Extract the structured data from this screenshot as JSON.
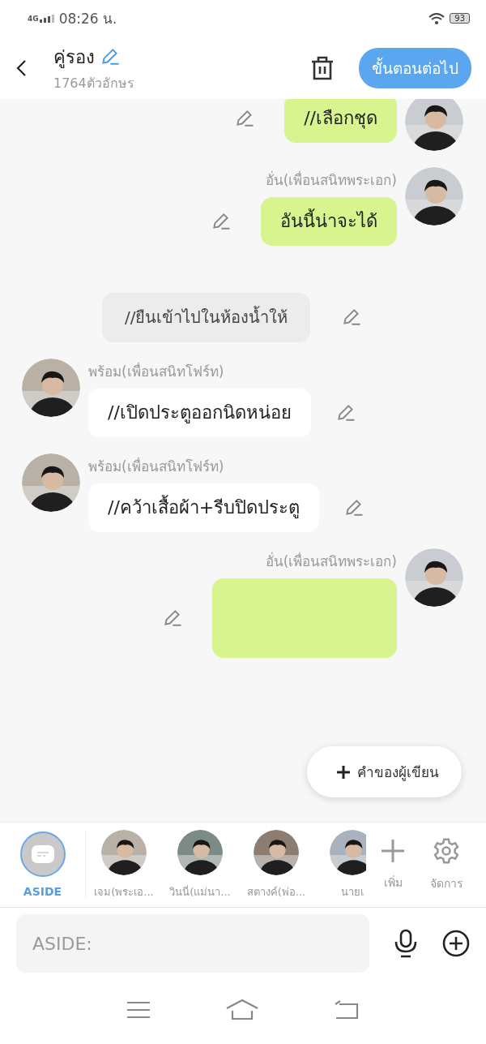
{
  "status_bar": {
    "network": "4G",
    "time": "08:26 น.",
    "battery": "93"
  },
  "header": {
    "title": "คู่รอง",
    "char_count": "1764ตัวอักษร",
    "next_button": "ขั้นตอนต่อไป"
  },
  "messages": [
    {
      "kind": "right",
      "text": "//เลือกชุด"
    },
    {
      "kind": "right",
      "name": "อั่น(เพื่อนสนิทพระเอก)",
      "text": "อันนี้น่าจะได้"
    },
    {
      "kind": "narration",
      "text": "//ยืนเข้าไปในห้องน้ำให้"
    },
    {
      "kind": "left",
      "name": "พร้อม(เพื่อนสนิทโฟร์ท)",
      "text": "//เปิดประตูออกนิดหน่อย"
    },
    {
      "kind": "left",
      "name": "พร้อม(เพื่อนสนิทโฟร์ท)",
      "text": "//คว้าเสื้อผ้า+รีบปิดประตู"
    },
    {
      "kind": "right",
      "name": "อั่น(เพื่อนสนิทพระเอก)"
    }
  ],
  "popup": {
    "label": "คำของผู้เขียน"
  },
  "characters": [
    {
      "kind": "aside",
      "label": "ASIDE",
      "selected": true
    },
    {
      "kind": "person",
      "label": "เจม(พระเอ...",
      "selected": false
    },
    {
      "kind": "person",
      "label": "วินนี่(แม่นา...",
      "selected": false
    },
    {
      "kind": "person",
      "label": "สตางค์(พ่อ...",
      "selected": false
    },
    {
      "kind": "person",
      "label": "นายเ",
      "selected": false
    }
  ],
  "add_label": "เพิ่ม",
  "manage_label": "จัดการ",
  "input": {
    "placeholder": "ASIDE:"
  }
}
